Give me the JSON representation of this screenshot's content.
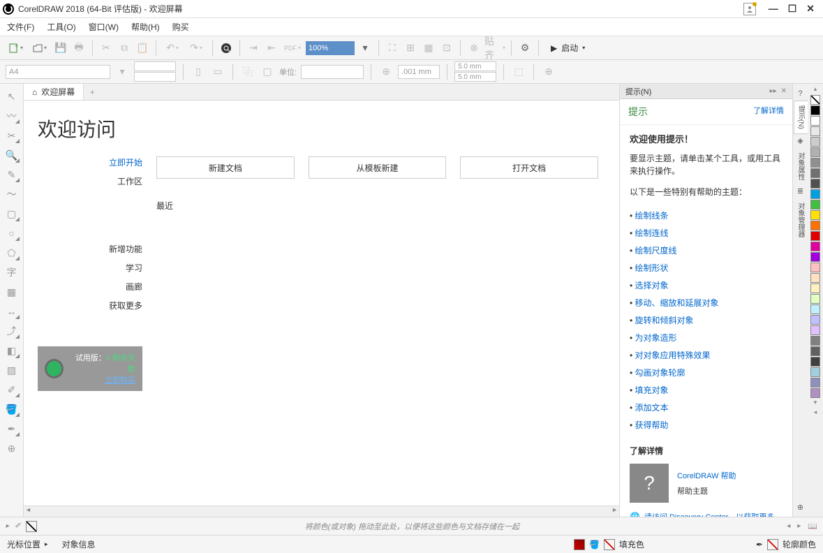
{
  "title": "CorelDRAW 2018 (64-Bit 评估版) - 欢迎屏幕",
  "menu": {
    "file": "文件(F)",
    "tools": "工具(O)",
    "window": "窗口(W)",
    "help": "帮助(H)",
    "buy": "购买"
  },
  "toolbar": {
    "zoom": "100%",
    "snap": "贴齐",
    "launch": "启动"
  },
  "propbar": {
    "page_size": "A4",
    "units_label": "单位:",
    "nudge": ".001 mm",
    "dup_x": "5.0 mm",
    "dup_y": "5.0 mm"
  },
  "doc_tab": "欢迎屏幕",
  "welcome": {
    "heading": "欢迎访问",
    "nav": {
      "start": "立即开始",
      "workspace": "工作区",
      "new_features": "新增功能",
      "learn": "学习",
      "gallery": "画廊",
      "get_more": "获取更多"
    },
    "buttons": {
      "new_doc": "新建文档",
      "from_template": "从模板新建",
      "open_doc": "打开文档"
    },
    "recent": "最近",
    "trial": {
      "label": "试用版：",
      "days": "0 剩余天数",
      "buy": "立即购买"
    }
  },
  "hints": {
    "tab": "提示(N)",
    "header": "提示",
    "learn_more": "了解详情",
    "welcome_title": "欢迎使用提示！",
    "intro": "要显示主题，请单击某个工具，或用工具来执行操作。",
    "helpful_intro": "以下是一些特别有帮助的主题：",
    "topics": [
      "绘制线条",
      "绘制连线",
      "绘制尺度线",
      "绘制形状",
      "选择对象",
      "移动、缩放和延展对象",
      "旋转和倾斜对象",
      "为对象造形",
      "对对象应用特殊效果",
      "勾画对象轮廓",
      "填充对象",
      "添加文本",
      "获得帮助"
    ],
    "more_title": "了解详情",
    "help_link": "CorelDRAW 帮助",
    "help_sub": "帮助主题",
    "discovery": "请访问 Discovery Center，以获取更多"
  },
  "right_tabs": {
    "hints": "提示(N)",
    "obj_props": "对象属性",
    "obj_mgr": "对象管理器"
  },
  "colorbar_hint": "将颜色(或对象) 拖动至此处，以便将这些颜色与文档存储在一起",
  "status": {
    "cursor": "光标位置",
    "obj_info": "对象信息",
    "fill": "填充色",
    "outline": "轮廓颜色"
  },
  "palette": [
    "#000000",
    "#ffffff",
    "#e8e8e8",
    "#cccccc",
    "#b0b0b0",
    "#909090",
    "#707070",
    "#505050",
    "#00a0e0",
    "#40c040",
    "#ffe000",
    "#ff7000",
    "#e00000",
    "#e000a0",
    "#a000e0",
    "#ffc0c0",
    "#ffe0c0",
    "#fff0c0",
    "#e0ffc0",
    "#c0f0ff",
    "#c0c0ff",
    "#e0c0ff",
    "#808080",
    "#606060",
    "#404040",
    "#a0d0e0",
    "#9090c0",
    "#b090c0"
  ]
}
